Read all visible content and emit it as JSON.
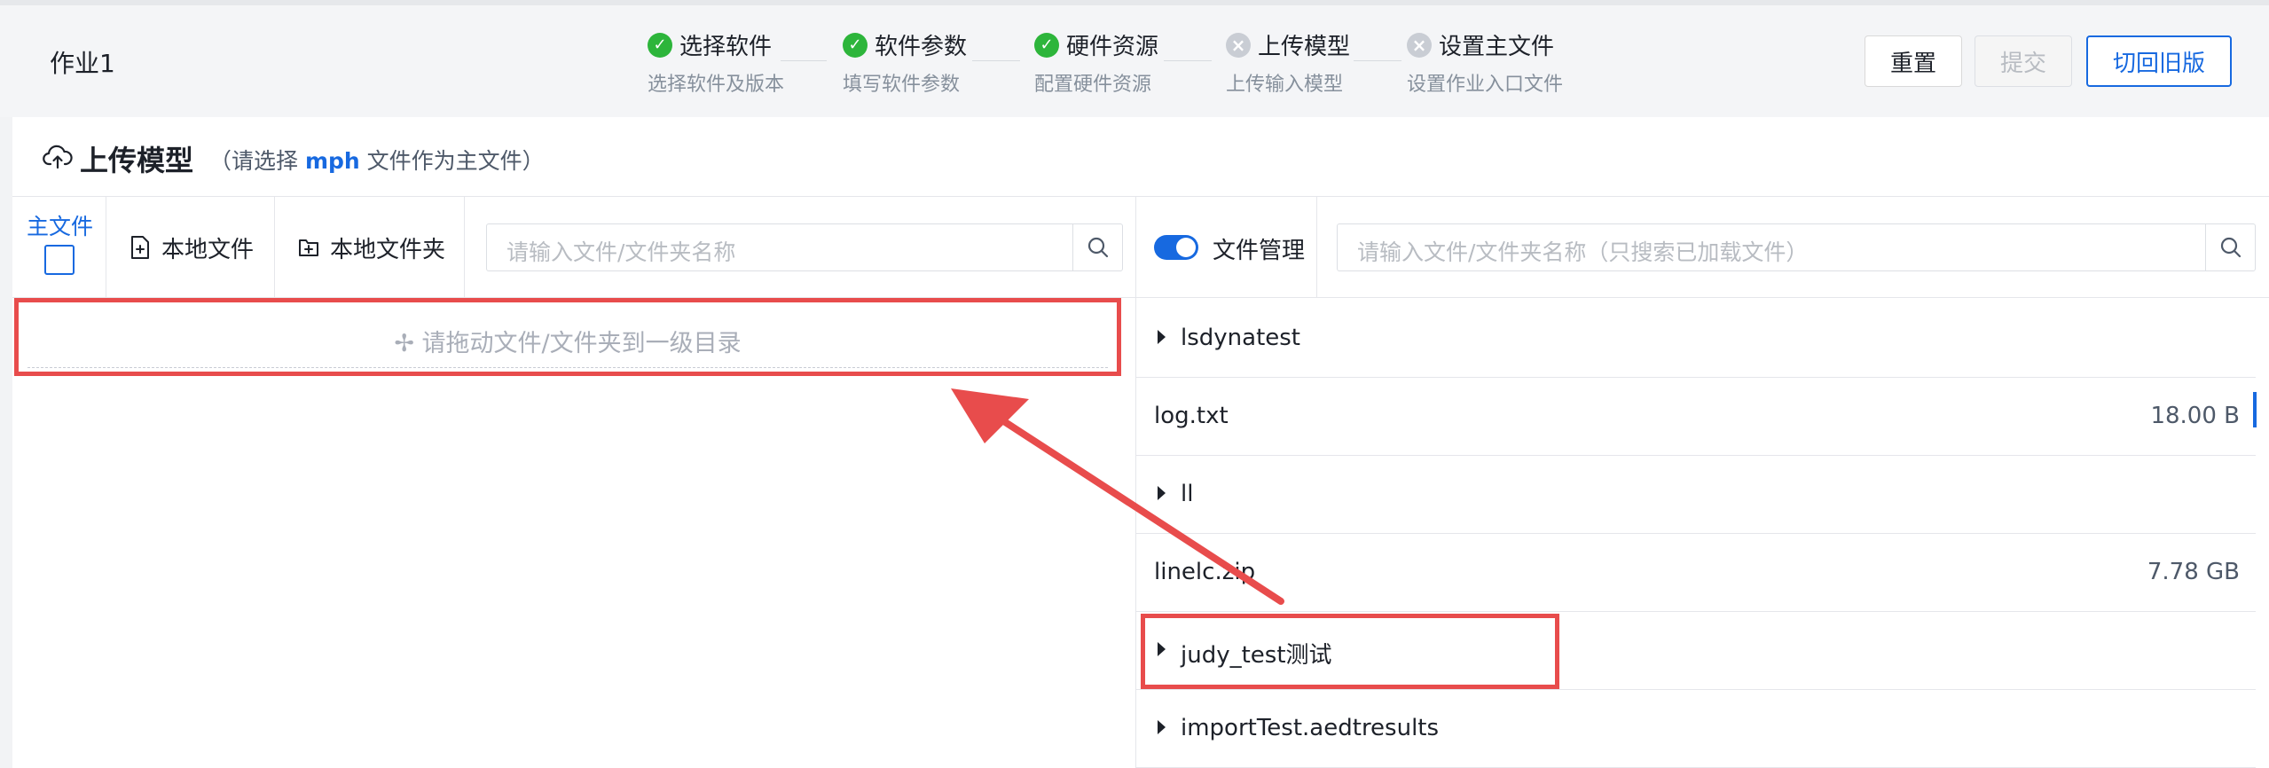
{
  "job": {
    "title": "作业1"
  },
  "steps": [
    {
      "title": "选择软件",
      "desc": "选择软件及版本",
      "status": "done"
    },
    {
      "title": "软件参数",
      "desc": "填写软件参数",
      "status": "done"
    },
    {
      "title": "硬件资源",
      "desc": "配置硬件资源",
      "status": "done"
    },
    {
      "title": "上传模型",
      "desc": "上传输入模型",
      "status": "pending"
    },
    {
      "title": "设置主文件",
      "desc": "设置作业入口文件",
      "status": "pending"
    }
  ],
  "step_icons": {
    "done": "✓",
    "pending": "×"
  },
  "buttons": {
    "reset": "重置",
    "submit": "提交",
    "old_version": "切回旧版"
  },
  "upload": {
    "title": "上传模型",
    "hint_prefix": "（请选择",
    "hint_accent": "mph",
    "hint_suffix": "文件作为主文件）"
  },
  "left": {
    "main_file_label": "主文件",
    "local_file": "本地文件",
    "local_folder": "本地文件夹",
    "search_placeholder": "请输入文件/文件夹名称",
    "drop_hint": "请拖动文件/文件夹到一级目录",
    "drop_icon": "✢"
  },
  "right": {
    "toggle_label": "文件管理",
    "search_placeholder": "请输入文件/文件夹名称（只搜索已加载文件）",
    "files": [
      {
        "name": "lsdynatest",
        "type": "folder",
        "size": ""
      },
      {
        "name": "log.txt",
        "type": "file",
        "size": "18.00 B"
      },
      {
        "name": "ll",
        "type": "folder",
        "size": ""
      },
      {
        "name": "linelc.zip",
        "type": "file",
        "size": "7.78 GB"
      },
      {
        "name": "judy_test测试",
        "type": "folder",
        "size": ""
      },
      {
        "name": "importTest.aedtresults",
        "type": "folder",
        "size": ""
      }
    ]
  },
  "colors": {
    "accent": "#1769e0",
    "success": "#2db53b",
    "annotation": "#e84c4c"
  }
}
